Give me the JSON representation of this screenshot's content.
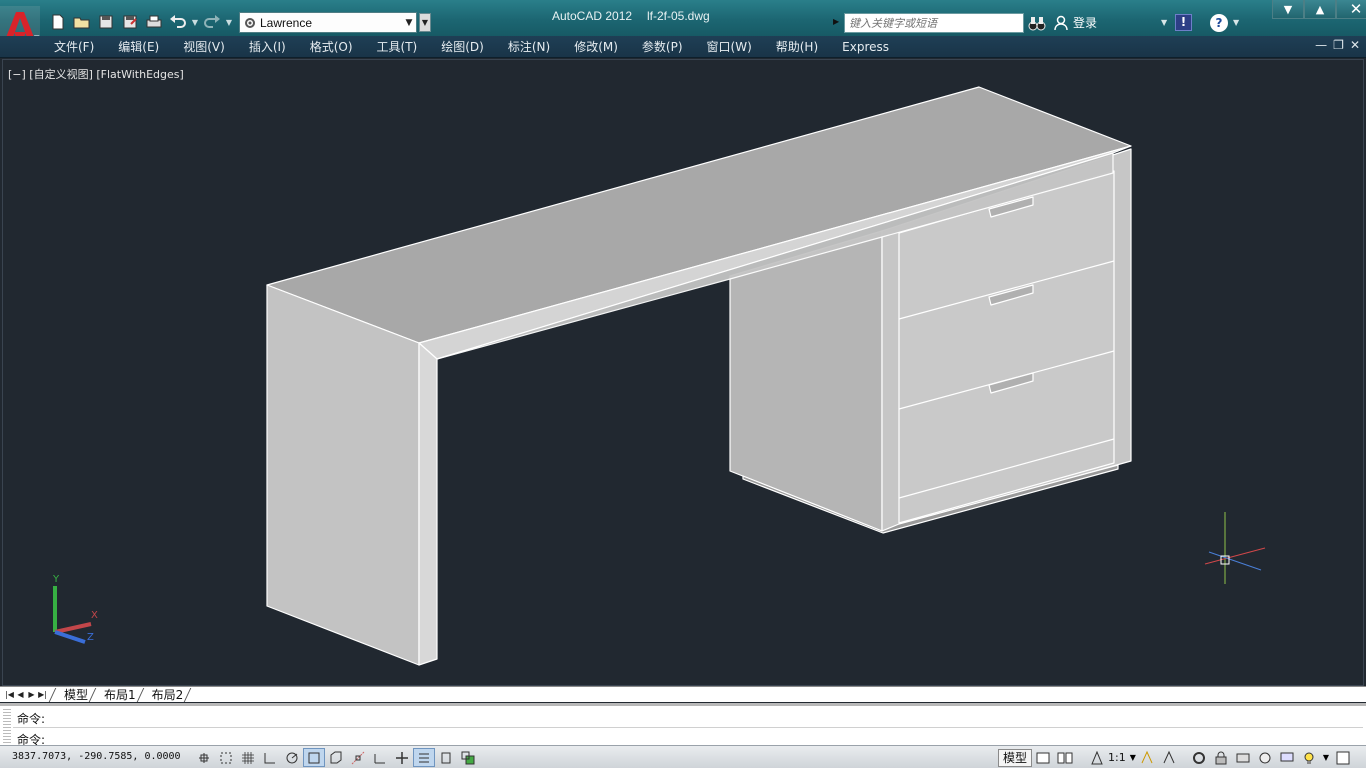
{
  "titlebar": {
    "app_title": "AutoCAD 2012",
    "file_title": "lf-2f-05.dwg",
    "workspace": "Lawrence",
    "search_placeholder": "键入关键字或短语",
    "login_label": "登录",
    "help_label": "?",
    "exchange_label": "!",
    "colors": {
      "titlebar": "#1c6672",
      "menubar": "#1f3f55",
      "viewport": "#212830"
    }
  },
  "quick_access": [
    {
      "name": "new-icon"
    },
    {
      "name": "open-icon"
    },
    {
      "name": "save-icon"
    },
    {
      "name": "saveas-icon"
    },
    {
      "name": "plot-icon"
    },
    {
      "name": "undo-icon"
    },
    {
      "name": "redo-icon"
    }
  ],
  "menu": {
    "items": [
      "文件(F)",
      "编辑(E)",
      "视图(V)",
      "插入(I)",
      "格式(O)",
      "工具(T)",
      "绘图(D)",
      "标注(N)",
      "修改(M)",
      "参数(P)",
      "窗口(W)",
      "帮助(H)",
      "Express"
    ]
  },
  "viewport": {
    "label": "[−] [自定义视图] [FlatWithEdges]",
    "ucs_axes": {
      "x": "X",
      "y": "Y",
      "z": "Z"
    }
  },
  "layout_tabs": {
    "tabs": [
      "模型",
      "布局1",
      "布局2"
    ],
    "active": "模型"
  },
  "command": {
    "history": "命令:",
    "prompt": "命令:"
  },
  "status": {
    "coordinates": "3837.7073,  -290.7585,  0.0000",
    "model_label": "模型",
    "annotation_scale": "1:1"
  }
}
